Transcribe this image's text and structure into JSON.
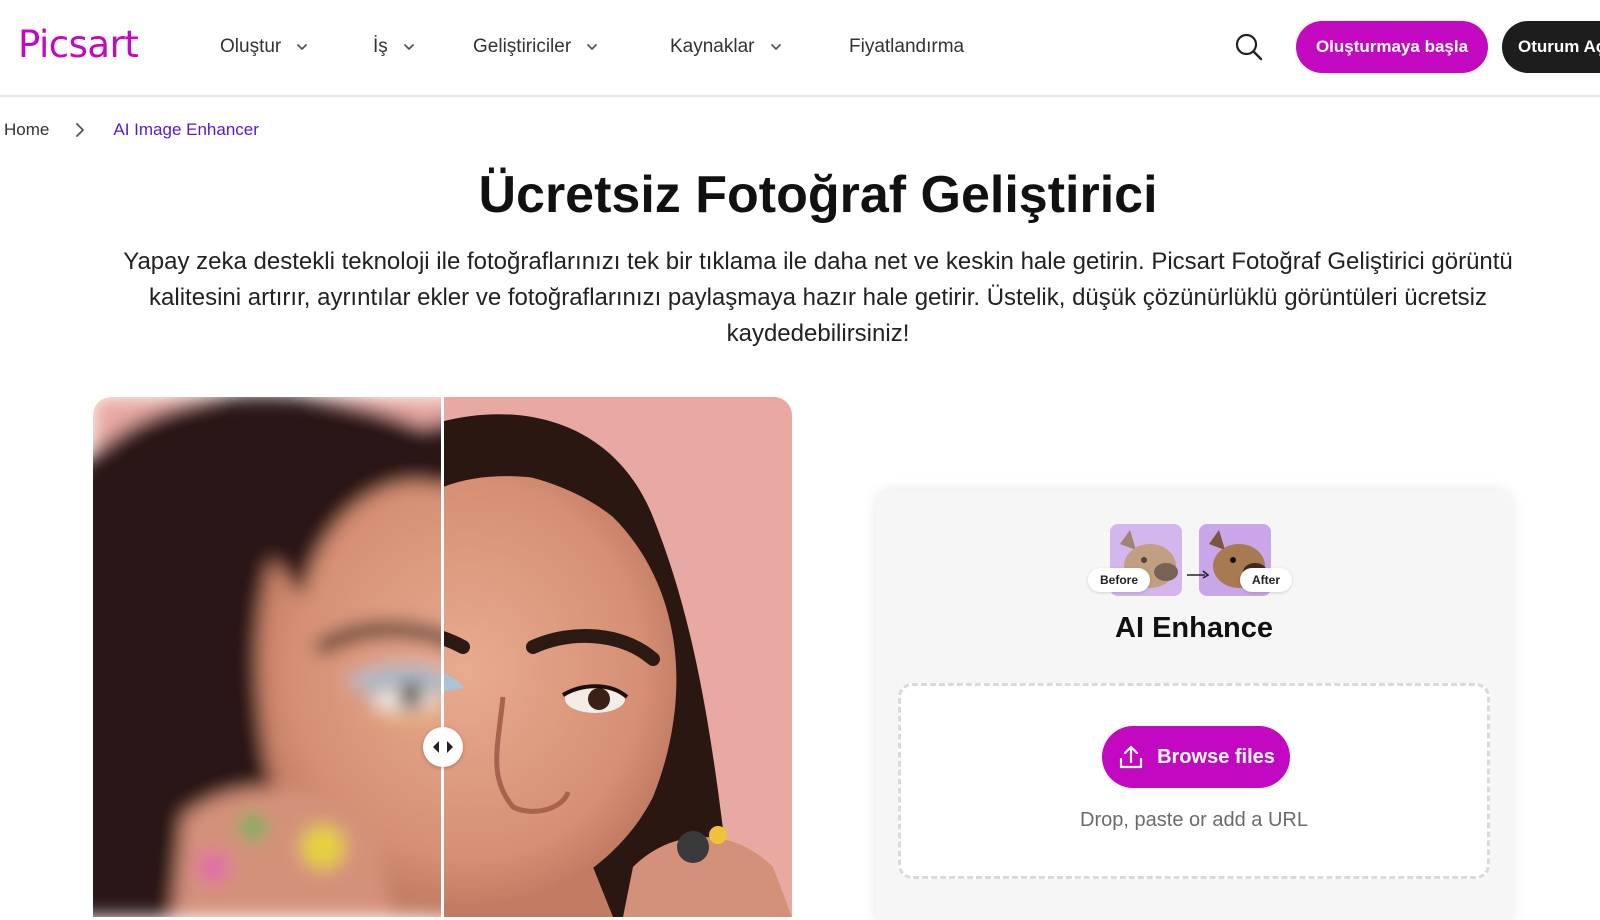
{
  "brand": {
    "logo_text": "Picsart",
    "accent_color": "#c209c1",
    "link_color": "#5a16d6"
  },
  "nav": {
    "items": [
      {
        "label": "Oluştur",
        "has_dropdown": true
      },
      {
        "label": "İş",
        "has_dropdown": true
      },
      {
        "label": "Geliştiriciler",
        "has_dropdown": true
      },
      {
        "label": "Kaynaklar",
        "has_dropdown": true
      },
      {
        "label": "Fiyatlandırma",
        "has_dropdown": false
      }
    ],
    "search_icon": "search-icon",
    "cta_label": "Oluşturmaya başla",
    "login_label": "Oturum Aç"
  },
  "breadcrumb": {
    "home": "Home",
    "current": "AI Image Enhancer"
  },
  "hero": {
    "title": "Ücretsiz Fotoğraf Geliştirici",
    "description": "Yapay zeka destekli teknoloji ile fotoğraflarınızı tek bir tıklama ile daha net ve keskin hale getirin. Picsart Fotoğraf Geliştirici görüntü kalitesini artırır, ayrıntılar ekler ve fotoğraflarınızı paylaşmaya hazır hale getirir. Üstelik, düşük çözünürlüklü görüntüleri ücretsiz kaydedebilirsiniz!"
  },
  "compare": {
    "left_state": "blurred",
    "right_state": "sharp",
    "handle_icon": "drag-arrows-icon"
  },
  "upload_card": {
    "before_label": "Before",
    "after_label": "After",
    "title": "AI Enhance",
    "browse_label": "Browse files",
    "upload_icon": "upload-icon",
    "hint": "Drop, paste or add a URL"
  }
}
